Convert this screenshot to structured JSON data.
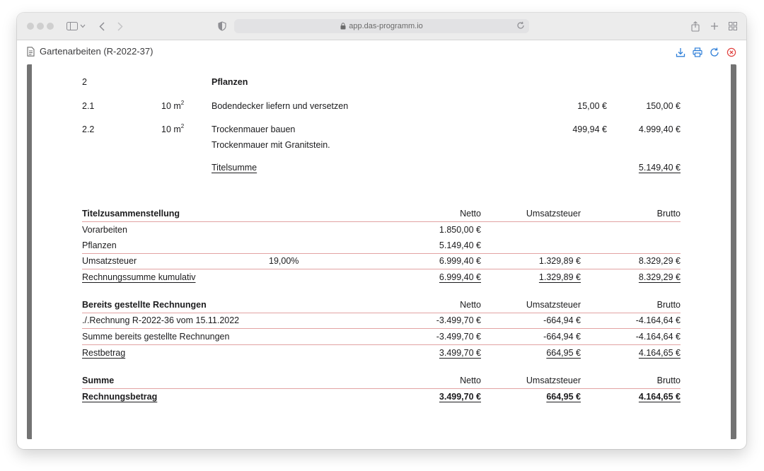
{
  "browser": {
    "url": "app.das-programm.io"
  },
  "app": {
    "title": "Gartenarbeiten (R-2022-37)"
  },
  "positions": {
    "group_no": "2",
    "group_title": "Pflanzen",
    "items": [
      {
        "no": "2.1",
        "qty": "10 m",
        "unit_sup": "2",
        "text": "Bodendecker liefern und versetzen",
        "unit_price": "15,00 €",
        "total": "150,00 €"
      },
      {
        "no": "2.2",
        "qty": "10 m",
        "unit_sup": "2",
        "text": "Trockenmauer bauen",
        "subtext": "Trockenmauer mit Granitstein.",
        "unit_price": "499,94 €",
        "total": "4.999,40 €"
      }
    ],
    "titlesum_label": "Titelsumme",
    "titlesum_value": "5.149,40 €"
  },
  "summary": {
    "heading": "Titelzusammenstellung",
    "col_netto": "Netto",
    "col_ust": "Umsatzsteuer",
    "col_brutto": "Brutto",
    "rows": [
      {
        "label": "Vorarbeiten",
        "netto": "1.850,00 €"
      },
      {
        "label": "Pflanzen",
        "netto": "5.149,40 €"
      },
      {
        "label": "Umsatzsteuer",
        "rate": "19,00%",
        "netto": "6.999,40 €",
        "ust": "1.329,89 €",
        "brutto": "8.329,29 €"
      },
      {
        "label": "Rechnungssumme kumulativ",
        "netto": "6.999,40 €",
        "ust": "1.329,89 €",
        "brutto": "8.329,29 €"
      }
    ]
  },
  "previous": {
    "heading": "Bereits gestellte Rechnungen",
    "col_netto": "Netto",
    "col_ust": "Umsatzsteuer",
    "col_brutto": "Brutto",
    "rows": [
      {
        "label": "./.Rechnung R-2022-36 vom 15.11.2022",
        "netto": "-3.499,70 €",
        "ust": "-664,94 €",
        "brutto": "-4.164,64 €"
      },
      {
        "label": "Summe bereits gestellte Rechnungen",
        "netto": "-3.499,70 €",
        "ust": "-664,94 €",
        "brutto": "-4.164,64 €"
      },
      {
        "label": "Restbetrag",
        "netto": "3.499,70 €",
        "ust": "664,95 €",
        "brutto": "4.164,65 €"
      }
    ]
  },
  "total": {
    "heading": "Summe",
    "col_netto": "Netto",
    "col_ust": "Umsatzsteuer",
    "col_brutto": "Brutto",
    "label": "Rechnungsbetrag",
    "netto": "3.499,70 €",
    "ust": "664,95 €",
    "brutto": "4.164,65 €"
  },
  "colors": {
    "accent": "#2f7fd8",
    "close": "#e0413f",
    "rule": "#e2a3a3"
  }
}
